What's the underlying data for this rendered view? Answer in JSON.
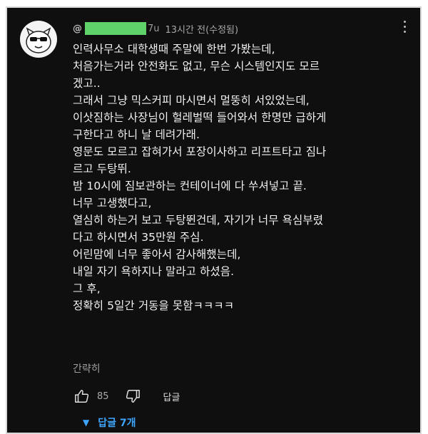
{
  "comment": {
    "handle_prefix": "@",
    "handle_suffix": "7u",
    "timestamp": "13시간 전(수정됨)",
    "lines": [
      "인력사무소 대학생때 주말에 한번 가봤는데,",
      "처음가는거라 안전화도 없고, 무슨 시스템인지도 모르",
      "겠고..",
      "그래서 그냥 믹스커피 마시면서 멀뚱히 서있었는데,",
      "이삿짐하는 사장님이 헐레벌떡 들어와서 한명만 급하게",
      "구한다고 하니 날 데려가래.",
      "영문도 모르고 잡혀가서 포장이사하고 리프트타고 짐나",
      "르고 두탕뛰.",
      "밤 10시에 짐보관하는 컨테이너에 다 쑤셔넣고 끝.",
      "너무 고생했다고,",
      "열심히 하는거 보고 두탕뛴건데, 자기가 너무 욕심부렸",
      "다고 하시면서 35만원 주심.",
      "어린맘에 너무 좋아서 감사해했는데,",
      "내일 자기 욕하지나 말라고 하셨음.",
      "그 후,",
      "정확히 5일간 거동을 못함ㅋㅋㅋㅋ"
    ],
    "show_less": "간략히",
    "like_count": "85",
    "reply_label": "답글",
    "replies_label": "답글 7개"
  },
  "colors": {
    "background": "#0f0f0f",
    "text": "#f1f1f1",
    "meta": "#aaaaaa",
    "link": "#3ea6ff",
    "censor": "#5fd36a"
  },
  "icons": {
    "avatar": "cartoon-face-avatar",
    "like": "thumbs-up-icon",
    "dislike": "thumbs-down-icon",
    "more": "vertical-dots-icon",
    "replies": "chevron-down-icon"
  }
}
